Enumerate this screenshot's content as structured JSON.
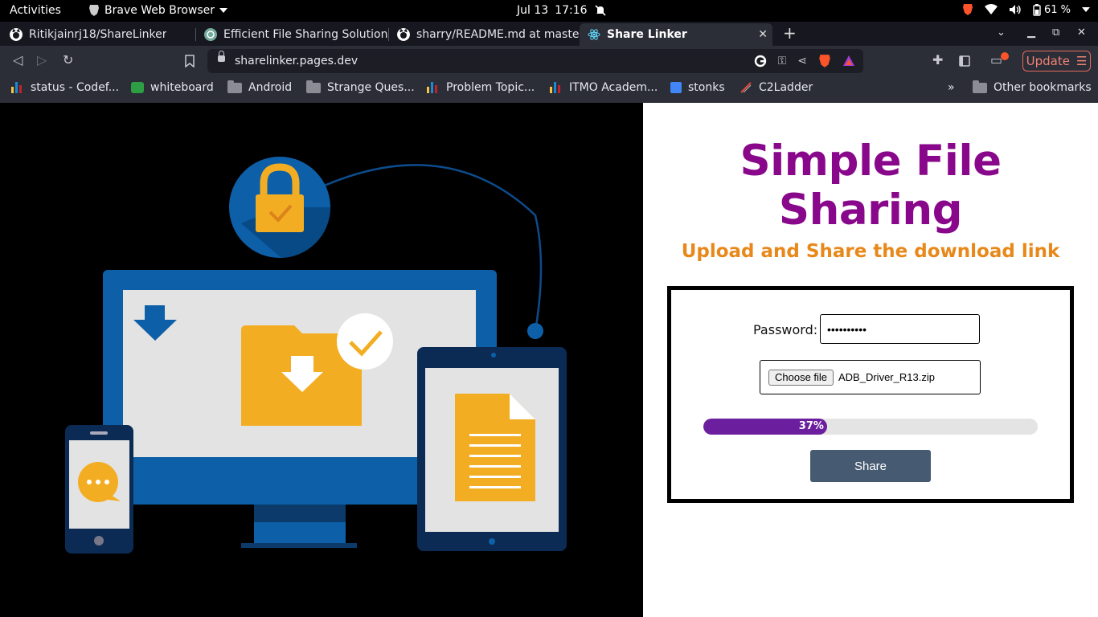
{
  "system_bar": {
    "activities": "Activities",
    "app_name": "Brave Web Browser",
    "date": "Jul 13",
    "time": "17:16",
    "battery": "61 %"
  },
  "tabs": [
    {
      "label": "Ritikjainrj18/ShareLinker",
      "icon": "github-icon",
      "active": false
    },
    {
      "label": "Efficient File Sharing Solution",
      "icon": "chatgpt-icon",
      "active": false
    },
    {
      "label": "sharry/README.md at master",
      "icon": "github-icon",
      "active": false
    },
    {
      "label": "Share Linker",
      "icon": "react-icon",
      "active": true
    }
  ],
  "toolbar": {
    "url": "sharelinker.pages.dev",
    "update_label": "Update"
  },
  "bookmarks": [
    {
      "label": "status - Codef...",
      "icon": "codeforces-icon"
    },
    {
      "label": "whiteboard",
      "icon": "whiteboard-icon"
    },
    {
      "label": "Android",
      "icon": "folder-icon"
    },
    {
      "label": "Strange Ques...",
      "icon": "folder-icon"
    },
    {
      "label": "Problem Topic...",
      "icon": "codeforces-icon"
    },
    {
      "label": "ITMO Academ...",
      "icon": "codeforces-icon"
    },
    {
      "label": "stonks",
      "icon": "docs-icon"
    },
    {
      "label": "C2Ladder",
      "icon": "ladder-icon"
    }
  ],
  "bookmarks_more": "»",
  "other_bookmarks": "Other bookmarks",
  "page": {
    "title": "Simple File Sharing",
    "subtitle": "Upload and Share the download link",
    "password_label": "Password:",
    "password_value": "••••••••••",
    "choose_file_label": "Choose file",
    "file_name": "ADB_Driver_R13.zip",
    "progress_percent": 37,
    "progress_label": "37%",
    "share_label": "Share"
  },
  "colors": {
    "title": "#88078a",
    "subtitle": "#e8881a",
    "progress": "#6b1f9e",
    "share_button": "#465a72",
    "brave_orange": "#fb542b"
  }
}
